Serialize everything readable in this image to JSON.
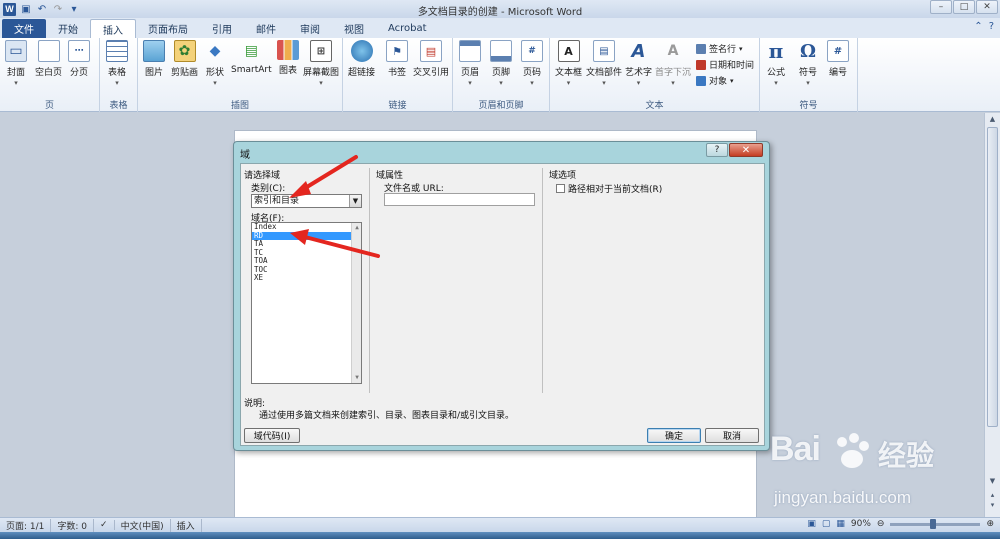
{
  "window": {
    "title": "多文档目录的创建 - Microsoft Word",
    "app_letter": "W",
    "controls": [
      "–",
      "□",
      "✕"
    ]
  },
  "tabs": [
    {
      "label": "文件"
    },
    {
      "label": "开始"
    },
    {
      "label": "插入"
    },
    {
      "label": "页面布局"
    },
    {
      "label": "引用"
    },
    {
      "label": "邮件"
    },
    {
      "label": "审阅"
    },
    {
      "label": "视图"
    },
    {
      "label": "Acrobat"
    }
  ],
  "ribbon": {
    "groups": [
      {
        "label": "页",
        "buttons": [
          "封面",
          "空白页",
          "分页"
        ]
      },
      {
        "label": "表格",
        "buttons": [
          "表格"
        ]
      },
      {
        "label": "插图",
        "buttons": [
          "图片",
          "剪贴画",
          "形状",
          "SmartArt",
          "图表",
          "屏幕截图"
        ]
      },
      {
        "label": "链接",
        "buttons": [
          "超链接",
          "书签",
          "交叉引用"
        ]
      },
      {
        "label": "页眉和页脚",
        "buttons": [
          "页眉",
          "页脚",
          "页码"
        ]
      },
      {
        "label": "文本",
        "buttons": [
          "文本框",
          "文档部件",
          "艺术字",
          "首字下沉"
        ],
        "small": [
          "签名行",
          "日期和时间",
          "对象"
        ]
      },
      {
        "label": "符号",
        "buttons": [
          "公式",
          "符号",
          "编号"
        ]
      }
    ]
  },
  "dialog": {
    "title": "域",
    "help": "?",
    "close": "✕",
    "choose_field": "请选择域",
    "category_label": "类别(C):",
    "category_value": "索引和目录",
    "field_names_label": "域名(F):",
    "field_names": [
      "Index",
      "RD",
      "TA",
      "TC",
      "TOA",
      "TOC",
      "XE"
    ],
    "selected_field": "RD",
    "field_properties": "域属性",
    "filename_label": "文件名或 URL:",
    "filename_value": "",
    "field_options": "域选项",
    "relative_path_label": "路径相对于当前文档(R)",
    "description_label": "说明:",
    "description_text": "通过使用多篇文档来创建索引、目录、图表目录和/或引文目录。",
    "field_codes_button": "域代码(I)",
    "ok_button": "确定",
    "cancel_button": "取消"
  },
  "statusbar": {
    "page": "页面: 1/1",
    "words": "字数: 0",
    "language": "中文(中国)",
    "mode": "插入",
    "zoom": "90%"
  },
  "watermark": {
    "logo": "Bai",
    "logo_cn": "经验",
    "url": "jingyan.baidu.com"
  }
}
